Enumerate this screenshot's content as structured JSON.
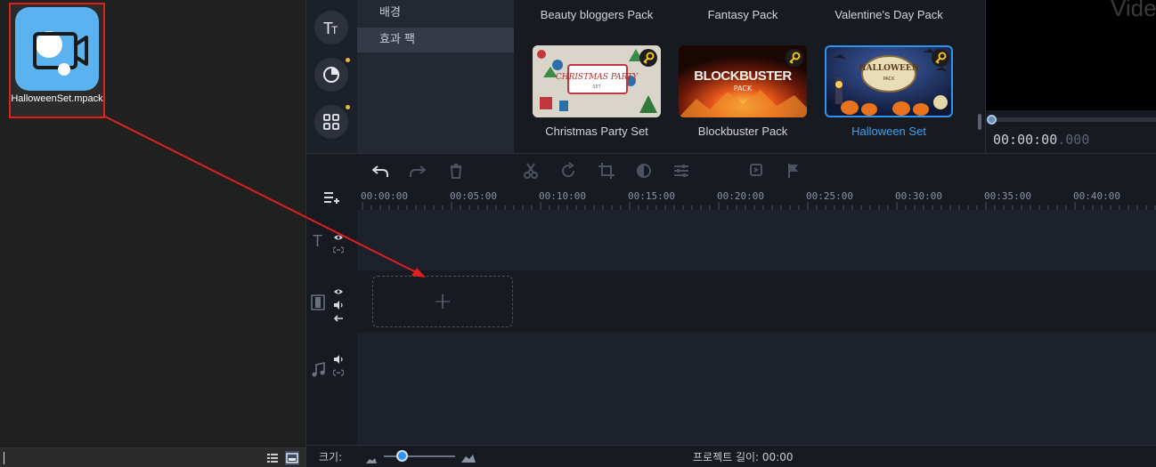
{
  "explorer": {
    "file": {
      "label": "HalloweenSet.mpack",
      "icon": "movavi-video-icon"
    },
    "status_icons": [
      "details-view-icon",
      "large-icons-view-icon"
    ]
  },
  "app": {
    "tool_rail": [
      "titles-icon",
      "transitions-icon",
      "more-tools-icon"
    ],
    "categories": [
      {
        "label": "배경",
        "active": false
      },
      {
        "label": "효과 팩",
        "active": true
      }
    ],
    "packs_top": [
      "Beauty bloggers Pack",
      "Fantasy Pack",
      "Valentine's Day Pack"
    ],
    "packs": [
      {
        "label": "Christmas Party Set",
        "thumb_text": "CHRISTMAS PARTY",
        "thumb_sub": "SET",
        "selected": false
      },
      {
        "label": "Blockbuster Pack",
        "thumb_text": "BLOCKBUSTER",
        "thumb_sub": "PACK",
        "selected": false
      },
      {
        "label": "Halloween Set",
        "thumb_text": "HALLOWEEN",
        "thumb_sub": "PACK",
        "selected": true
      }
    ],
    "preview": {
      "watermark": "Vide",
      "timecode_main": "00:00:00",
      "timecode_ms": ".000"
    },
    "timeline": {
      "toolbar": [
        "undo-icon",
        "redo-icon",
        "delete-icon",
        "cut-icon",
        "rotate-icon",
        "crop-icon",
        "color-adjust-icon",
        "settings-sliders-icon",
        "clip-properties-icon",
        "marker-flag-icon"
      ],
      "ruler": [
        "00:00:00",
        "00:05:00",
        "00:10:00",
        "00:15:00",
        "00:20:00",
        "00:25:00",
        "00:30:00",
        "00:35:00",
        "00:40:00"
      ],
      "drop_plus": "+"
    },
    "bottom": {
      "size_label": "크기:",
      "zoom_level": 0.25,
      "project_length": "프로젝트 길이:  00:00"
    }
  },
  "colors": {
    "accent": "#2d95f0",
    "arrow": "#e0201c",
    "highlight_border": "#e0201c"
  }
}
